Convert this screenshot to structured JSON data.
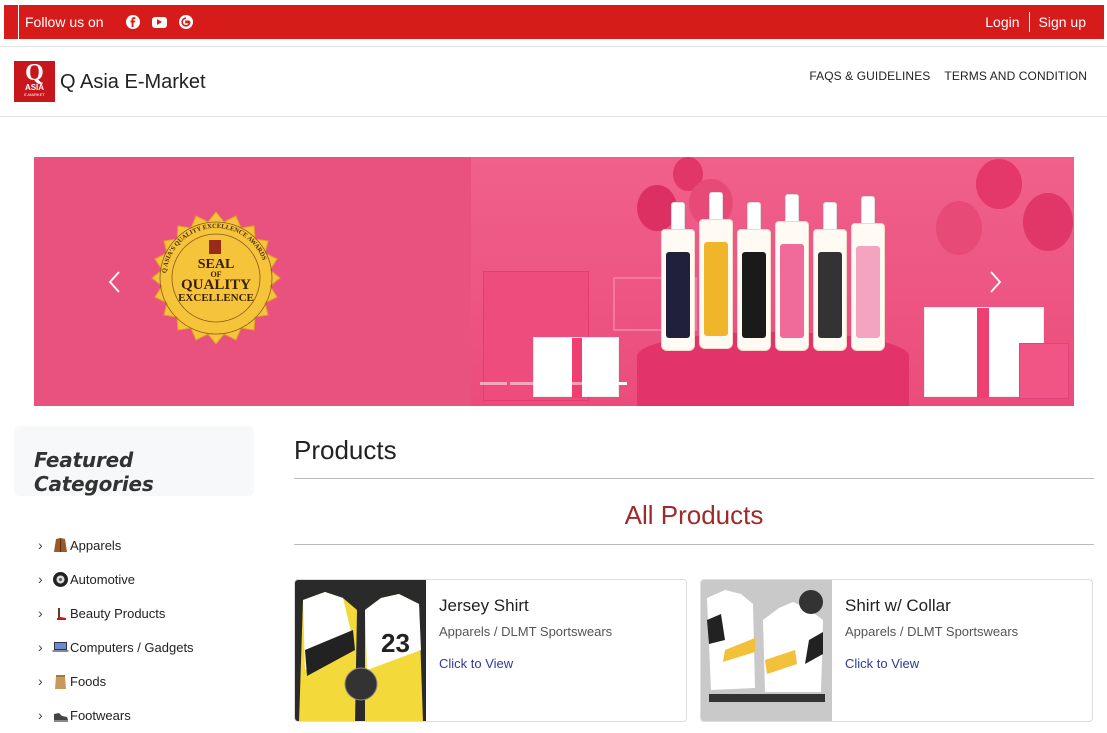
{
  "topbar": {
    "follow_label": "Follow us on",
    "social": [
      "facebook-icon",
      "youtube-icon",
      "google-icon"
    ],
    "login": "Login",
    "signup": "Sign up"
  },
  "header": {
    "logo_q": "Q",
    "logo_asia": "ASIA",
    "logo_sub": "E-MARKET",
    "brand": "Q Asia E-Market",
    "nav": [
      "FAQS & GUIDELINES",
      "TERMS AND CONDITION"
    ]
  },
  "banner": {
    "seal_line1": "SEAL",
    "seal_line2": "OF",
    "seal_line3": "QUALITY",
    "seal_line4": "EXCELLENCE",
    "seal_ring": "Q ASIA'S QUALITY EXCELLENCE AWARDS",
    "indicator_count": 5,
    "active_indicator": 4,
    "prev_icon": "chevron-left-icon",
    "next_icon": "chevron-right-icon"
  },
  "sidebar": {
    "title": "Featured Categories",
    "categories": [
      {
        "label": "Apparels",
        "icon": "jacket-icon"
      },
      {
        "label": "Automotive",
        "icon": "tire-icon"
      },
      {
        "label": "Beauty Products",
        "icon": "boot-icon"
      },
      {
        "label": "Computers / Gadgets",
        "icon": "laptop-icon"
      },
      {
        "label": "Foods",
        "icon": "food-bag-icon"
      },
      {
        "label": "Footwears",
        "icon": "shoe-icon"
      }
    ]
  },
  "products": {
    "title": "Products",
    "section": "All Products",
    "items": [
      {
        "name": "Jersey Shirt",
        "category": "Apparels / DLMT Sportswears",
        "cta": "Click to View",
        "jersey_number": "23"
      },
      {
        "name": "Shirt w/ Collar",
        "category": "Apparels / DLMT Sportswears",
        "cta": "Click to View"
      }
    ]
  },
  "colors": {
    "brand_red": "#d71a1a",
    "banner_pink": "#e9517e",
    "section_title": "#9e2a2b",
    "link_blue": "#2a3b9a"
  }
}
